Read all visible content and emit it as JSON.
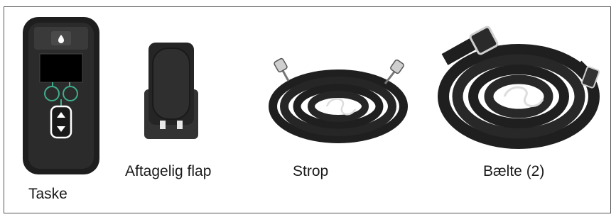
{
  "figure": {
    "items": [
      {
        "id": "case",
        "label": "Taske",
        "icon": "pump-case-icon"
      },
      {
        "id": "flap",
        "label": "Aftagelig flap",
        "icon": "removable-flap-icon"
      },
      {
        "id": "strap",
        "label": "Strop",
        "icon": "strap-icon"
      },
      {
        "id": "belt",
        "label": "Bælte (2)",
        "icon": "belt-icon"
      }
    ],
    "colors": {
      "body": "#222222",
      "screen": "#000000",
      "accent": "#3fae8d",
      "border": "#555555"
    }
  }
}
